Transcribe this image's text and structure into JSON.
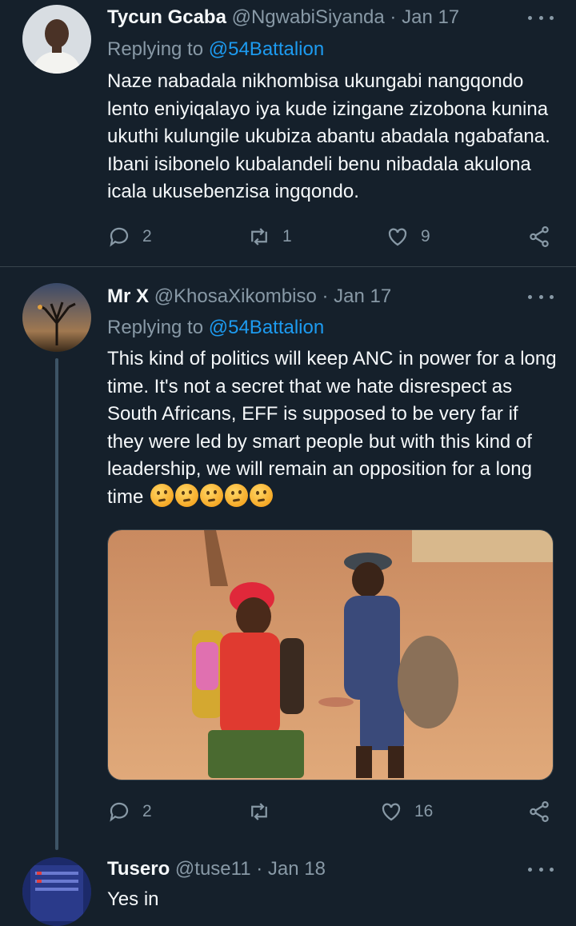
{
  "tweets": [
    {
      "name": "Tycun Gcaba",
      "handle": "@NgwabiSiyanda",
      "date": "Jan 17",
      "replying_prefix": "Replying to ",
      "replying_to": "@54Battalion",
      "text": "Naze nabadala nikhombisa ukungabi nangqondo lento eniyiqalayo iya kude izingane zizobona kunina ukuthi kulungile ukubiza abantu abadala ngabafana. Ibani isibonelo kubalandeli benu nibadala akulona icala ukusebenzisa ingqondo.",
      "replies": "2",
      "retweets": "1",
      "likes": "9"
    },
    {
      "name": "Mr X",
      "handle": "@KhosaXikombiso",
      "date": "Jan 17",
      "replying_prefix": "Replying to ",
      "replying_to": "@54Battalion",
      "text": "This kind of politics will keep ANC in power for a long time. It's not a secret that we hate disrespect as South Africans, EFF is supposed to be very far if they were led by smart people but with this kind of leadership, we will remain an opposition for a long time",
      "emoji": [
        "thinking-face",
        "thinking-face",
        "thinking-face",
        "thinking-face",
        "thinking-face"
      ],
      "replies": "2",
      "retweets": "",
      "likes": "16"
    },
    {
      "name": "Tusero",
      "handle": "@tuse11",
      "date": "Jan 18",
      "text": "Yes in"
    }
  ],
  "separator": "·",
  "colors": {
    "background": "#15202b",
    "text": "#f5f8fa",
    "secondary": "#8899a6",
    "link": "#1d9bf0",
    "divider": "#38444d"
  },
  "icons": [
    "reply-icon",
    "retweet-icon",
    "like-icon",
    "share-icon",
    "more-icon"
  ]
}
